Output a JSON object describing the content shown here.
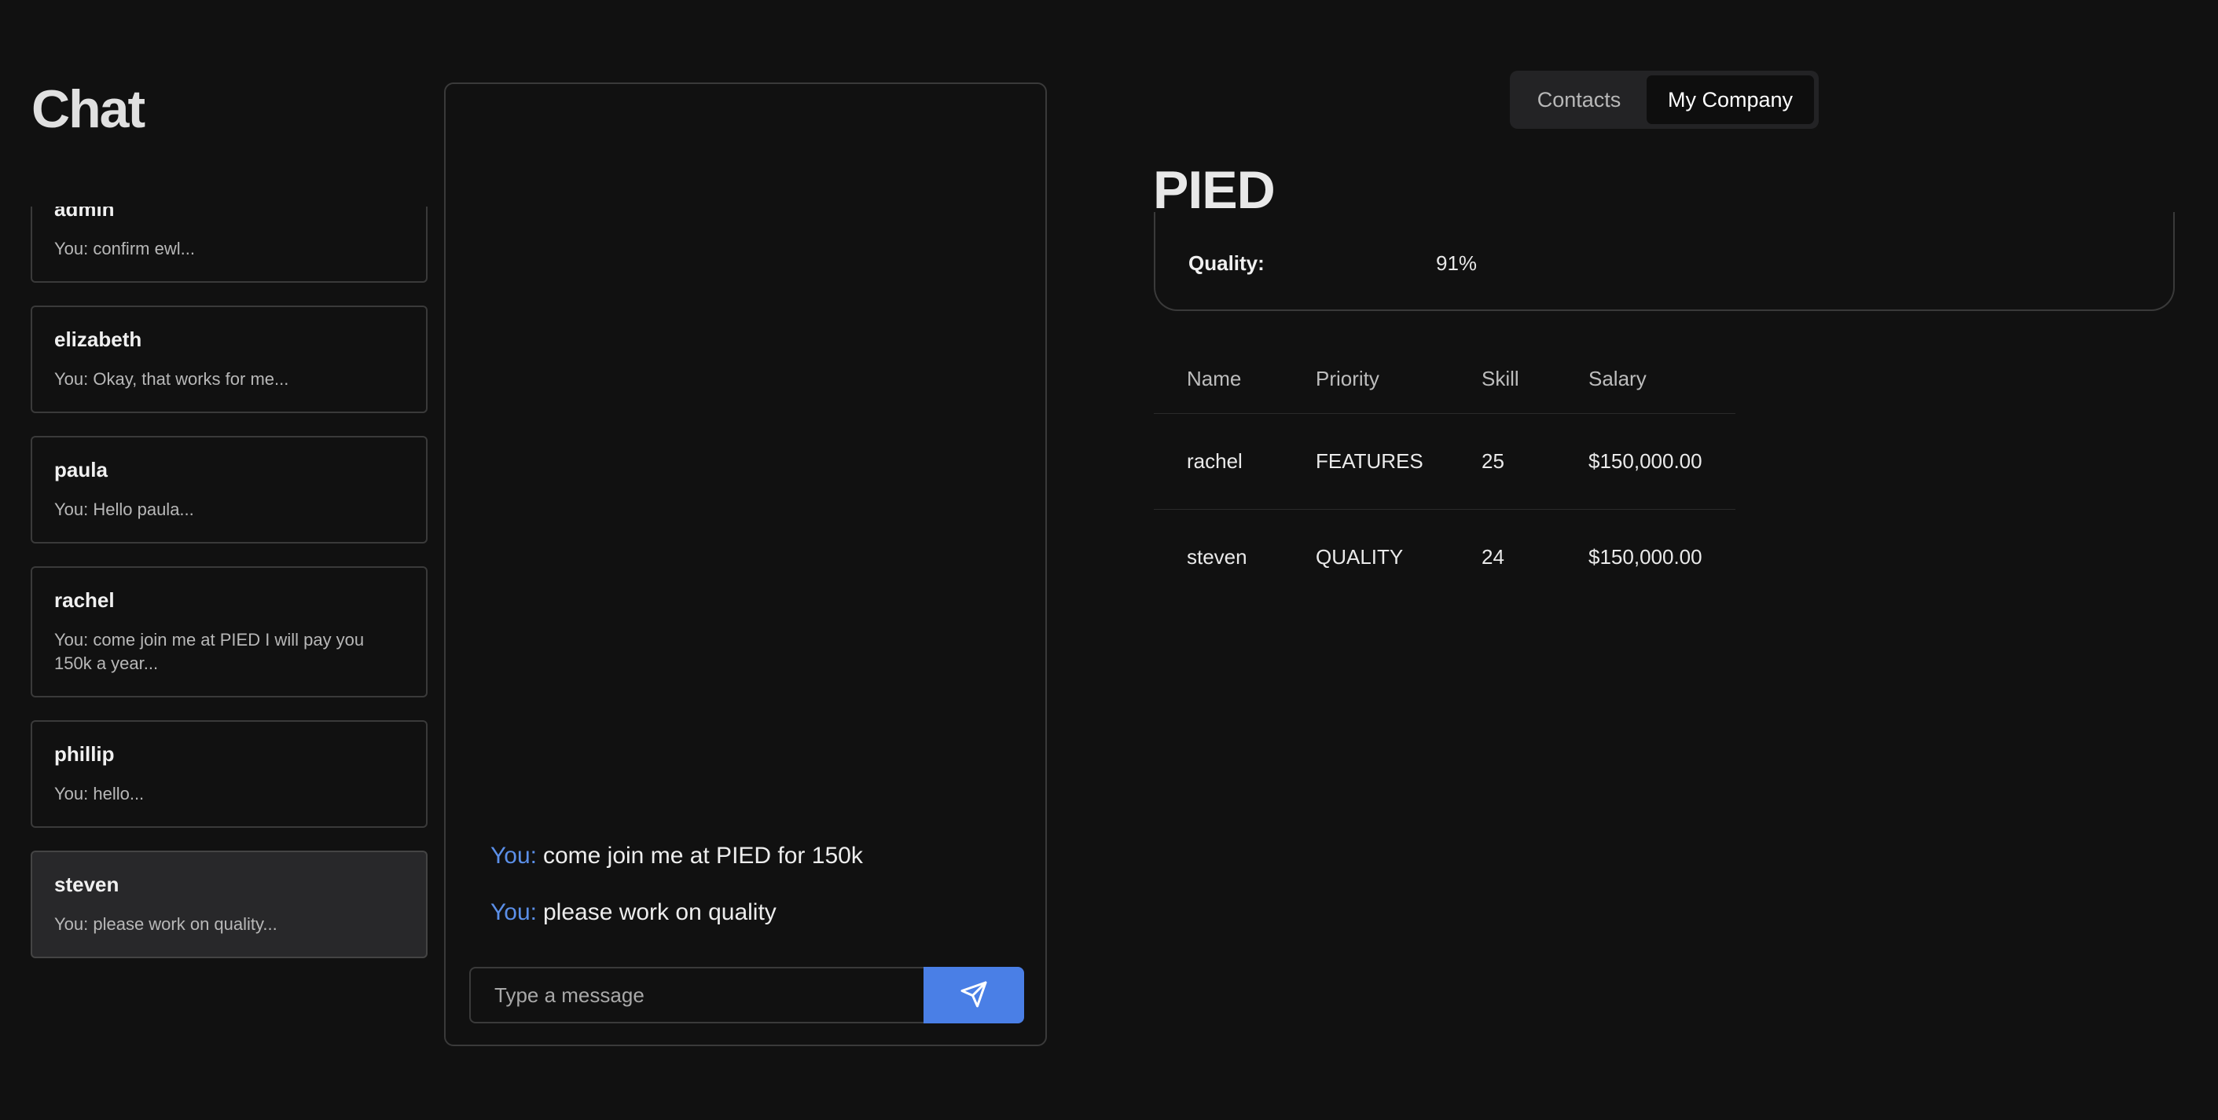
{
  "chat": {
    "title": "Chat",
    "contacts": [
      {
        "name": "admin",
        "preview": "You: confirm ewl..."
      },
      {
        "name": "elizabeth",
        "preview": "You: Okay, that works for me..."
      },
      {
        "name": "paula",
        "preview": "You: Hello paula..."
      },
      {
        "name": "rachel",
        "preview": "You: come join me at PIED I will pay you 150k a year..."
      },
      {
        "name": "phillip",
        "preview": "You: hello..."
      },
      {
        "name": "steven",
        "preview": "You: please work on quality..."
      }
    ],
    "messages": [
      {
        "sender": "You:",
        "text": "come join me at PIED for 150k"
      },
      {
        "sender": "You:",
        "text": "please work on quality"
      }
    ],
    "composer": {
      "placeholder": "Type a message",
      "send_icon": "send-icon"
    }
  },
  "tabs": {
    "contacts": "Contacts",
    "my_company": "My Company",
    "selected": "My Company"
  },
  "company": {
    "name": "PIED",
    "quality_label": "Quality:",
    "quality_value": "91%",
    "table": {
      "headers": [
        "Name",
        "Priority",
        "Skill",
        "Salary"
      ],
      "rows": [
        {
          "name": "rachel",
          "priority": "FEATURES",
          "skill": "25",
          "salary": "$150,000.00"
        },
        {
          "name": "steven",
          "priority": "QUALITY",
          "skill": "24",
          "salary": "$150,000.00"
        }
      ]
    }
  },
  "colors": {
    "background": "#111111",
    "accent": "#4a7fe6",
    "sender_label": "#5b8fe8"
  }
}
